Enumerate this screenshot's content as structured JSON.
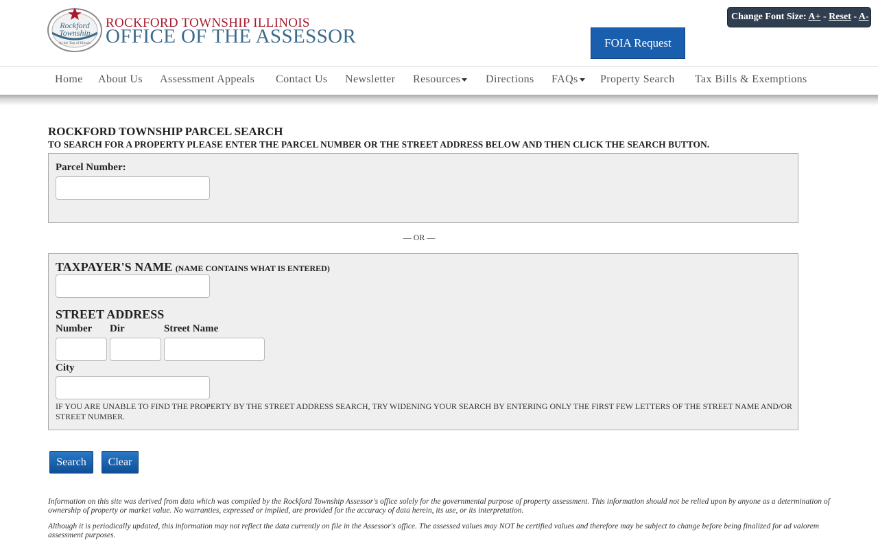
{
  "header": {
    "logo_text_line1": "Rockford",
    "logo_text_line2": "Township",
    "logo_tagline": "At the Top of Illinois",
    "brand_top": "ROCKFORD TOWNSHIP ILLINOIS",
    "brand_main": "OFFICE OF THE ASSESSOR",
    "foia_label": "FOIA Request",
    "font_size": {
      "label": "Change Font Size:",
      "increase": "A+",
      "reset": "Reset",
      "decrease": "A-",
      "separator": "-"
    }
  },
  "nav": {
    "items": [
      {
        "label": "Home"
      },
      {
        "label": "About Us"
      },
      {
        "label": "Assessment Appeals"
      },
      {
        "label": "Contact Us"
      },
      {
        "label": "Newsletter"
      },
      {
        "label": "Resources",
        "dropdown": true
      },
      {
        "label": "Directions"
      },
      {
        "label": "FAQs",
        "dropdown": true
      },
      {
        "label": "Property Search"
      },
      {
        "label": "Tax Bills & Exemptions"
      }
    ]
  },
  "search": {
    "title": "ROCKFORD TOWNSHIP PARCEL SEARCH",
    "subtitle": "TO SEARCH FOR A PROPERTY PLEASE ENTER THE PARCEL NUMBER OR THE STREET ADDRESS BELOW AND THEN CLICK THE SEARCH BUTTON.",
    "parcel_label": "Parcel Number:",
    "parcel_value": "",
    "or_text": "— OR —",
    "taxpayer_label": "TAXPAYER'S NAME",
    "taxpayer_hint": "(NAME CONTAINS WHAT IS ENTERED)",
    "taxpayer_value": "",
    "street_address_label": "STREET ADDRESS",
    "number_label": "Number",
    "dir_label": "Dir",
    "street_name_label": "Street Name",
    "city_label": "City",
    "note": "IF YOU ARE UNABLE TO FIND THE PROPERTY BY THE STREET ADDRESS SEARCH, TRY WIDENING YOUR SEARCH BY ENTERING ONLY THE FIRST FEW LETTERS OF THE STREET NAME AND/OR STREET NUMBER.",
    "search_button": "Search",
    "clear_button": "Clear"
  },
  "disclaimer": {
    "p1": "Information on this site was derived from data which was compiled by the Rockford Township Assessor's office solely for the governmental purpose of property assessment. This information should not be relied upon by anyone as a determination of ownership of property or market value. No warranties, expressed or implied, are provided for the accuracy of data herein, its use, or its interpretation.",
    "p2": "Although it is periodically updated, this information may not reflect the data currently on file in the Assessor's office. The assessed values may NOT be certified values and therefore may be subject to change before being finalized for ad valorem assessment purposes."
  },
  "colors": {
    "brand_red": "#a8192e",
    "brand_blue": "#3b6a8c",
    "button_blue": "#1a5fae",
    "panel_gray": "#efefef"
  }
}
